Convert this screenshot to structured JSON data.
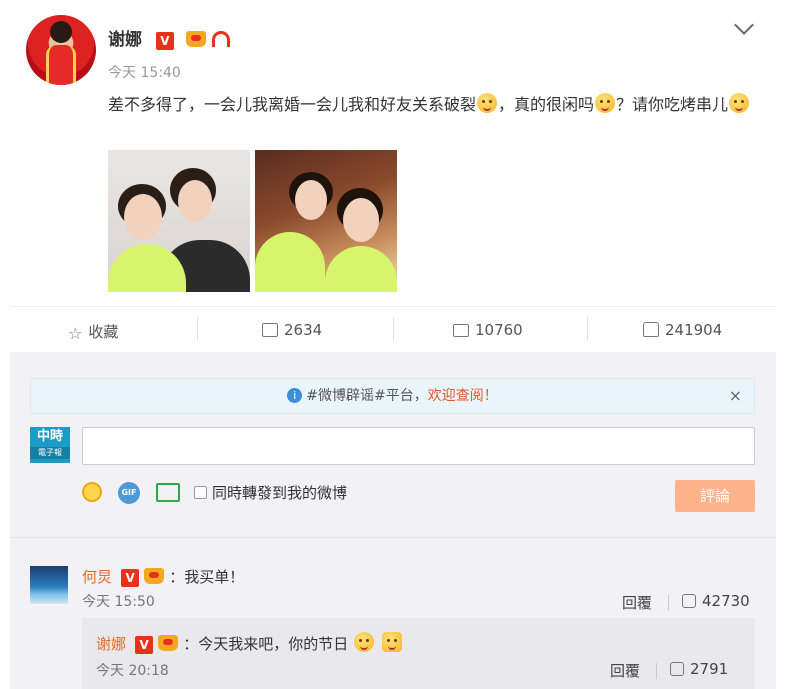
{
  "post": {
    "author": "谢娜",
    "verified_badge": "V",
    "time": "今天 15:40",
    "text_part1": "差不多得了，一会儿我离婚一会儿我和好友关系破裂",
    "text_part2": "，真的很闲吗",
    "text_part3": "？请你吃烤串儿",
    "images": [
      "photo-1",
      "photo-2"
    ]
  },
  "actions": {
    "favorite_label": "收藏",
    "share_count": "2634",
    "comment_count": "10760",
    "like_count": "241904"
  },
  "notice": {
    "prefix": "#微博辟谣#平台，",
    "highlight": "欢迎查阅！",
    "close": "×"
  },
  "composer": {
    "logo_top": "中時",
    "logo_bottom": "電子報",
    "gif_label": "GIF",
    "repost_label": "同時轉發到我的微博",
    "submit_label": "評論"
  },
  "comments": [
    {
      "author": "何炅",
      "verified_badge": "V",
      "text": "：我买单！",
      "time": "今天 15:50",
      "reply_label": "回覆",
      "likes": "42730",
      "reply": {
        "author": "谢娜",
        "verified_badge": "V",
        "text": "：今天我来吧，你的节日",
        "time": "今天 20:18",
        "reply_label": "回覆",
        "likes": "2791"
      }
    }
  ],
  "colors": {
    "accent_red": "#e8311a",
    "name_orange": "#e36b2b",
    "submit_bg": "#ffb38a",
    "notice_bg": "#eaf4fb"
  }
}
